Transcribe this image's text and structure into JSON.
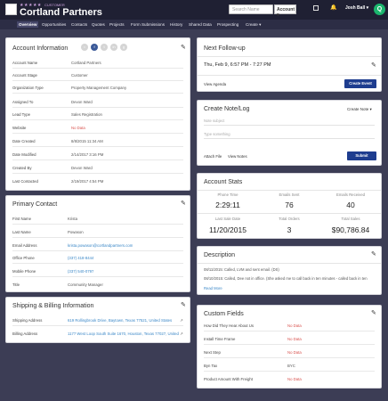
{
  "header": {
    "stars": "★★★★★",
    "customer_label": "CUSTOMER",
    "title": "Cortland Partners",
    "search_placeholder": "Search Name",
    "account_dropdown": "Account ▾",
    "bell": "🔔",
    "user": "Josh Ball ▾",
    "logo_letter": "Q"
  },
  "nav": [
    "Overview",
    "Opportunities",
    "Contacts",
    "Quotes",
    "Projects",
    "Form Submissions",
    "History",
    "Shared Data",
    "Prospecting",
    "Create ▾"
  ],
  "account_info": {
    "title": "Account Information",
    "rows": [
      {
        "label": "Account Name",
        "value": "Cortland Partners"
      },
      {
        "label": "Account Stage",
        "value": "Customer"
      },
      {
        "label": "Organization Type",
        "value": "Property Management Company"
      },
      {
        "label": "Assigned To",
        "value": "Devon Ward"
      },
      {
        "label": "Lead Type",
        "value": "Sales Registration"
      },
      {
        "label": "Website",
        "value": "No Data"
      },
      {
        "label": "Date Created",
        "value": "8/8/2015 11:34 AM"
      },
      {
        "label": "Date Modified",
        "value": "2/14/2017 3:16 PM"
      },
      {
        "label": "Created By",
        "value": "Devon Ward"
      },
      {
        "label": "Last Contacted",
        "value": "2/19/2017 4:54 PM"
      }
    ]
  },
  "primary_contact": {
    "title": "Primary Contact",
    "rows": [
      {
        "label": "First Name",
        "value": "Krista"
      },
      {
        "label": "Last Name",
        "value": "Powason"
      },
      {
        "label": "Email Address",
        "value": "krista.powason@cortlandpartners.com"
      },
      {
        "label": "Office Phone",
        "value": "(337) 418-8444"
      },
      {
        "label": "Mobile Phone",
        "value": "(337) 540-0797"
      },
      {
        "label": "Title",
        "value": "Community Manager"
      }
    ]
  },
  "shipping": {
    "title": "Shipping & Billing Information",
    "rows": [
      {
        "label": "Shipping Address",
        "value": "619 Rollingbrook Drive, Baytown, Texas 77521, United States"
      },
      {
        "label": "Billing Address",
        "value": "1177 West Loop South Suite 1670, Houston, Texas 77027, United States"
      }
    ]
  },
  "next_followup": {
    "title": "Next Follow-up",
    "datetime": "Thu, Feb 9, 6:57 PM - 7:27 PM",
    "view_agenda": "View Agenda",
    "create_event": "Create Event"
  },
  "create_note": {
    "title": "Create Note/Log",
    "dropdown": "Create Note ▾",
    "subject_placeholder": "Note subject",
    "body_placeholder": "Type something",
    "attach_file": "Attach File",
    "view_notes": "View Notes",
    "submit": "Submit"
  },
  "account_stats": {
    "title": "Account Stats",
    "stats": [
      {
        "label": "Phone Time",
        "value": "2:29:11"
      },
      {
        "label": "Emails Sent",
        "value": "76"
      },
      {
        "label": "Emails Received",
        "value": "40"
      },
      {
        "label": "Last Sale Date",
        "value": "11/20/2015"
      },
      {
        "label": "Total Orders",
        "value": "3"
      },
      {
        "label": "Total Sales",
        "value": "$90,786.84"
      }
    ]
  },
  "description": {
    "title": "Description",
    "line1": "08/11/2015: Called, LVM and sent email. (DS)",
    "line2": "08/10/2015: Called, Dee not in office. (She asked me to call back in ten minutes - called back in ten",
    "read_more": "Read More"
  },
  "custom_fields": {
    "title": "Custom Fields",
    "rows": [
      {
        "label": "How Did They Hear About Us",
        "value": "No Data"
      },
      {
        "label": "Install Time Frame",
        "value": "No Data"
      },
      {
        "label": "Next Step",
        "value": "No Data"
      },
      {
        "label": "Byn Tax",
        "value": "BYC"
      },
      {
        "label": "Product Amount With Freight",
        "value": "No Data"
      }
    ]
  },
  "colors": {
    "header_bg": "#1f2033",
    "nav_bg": "#2c2d45",
    "page_bg": "#3c3d55",
    "accent": "#1e3d8f",
    "nodata": "#d9534f",
    "link": "#3a87c7"
  }
}
